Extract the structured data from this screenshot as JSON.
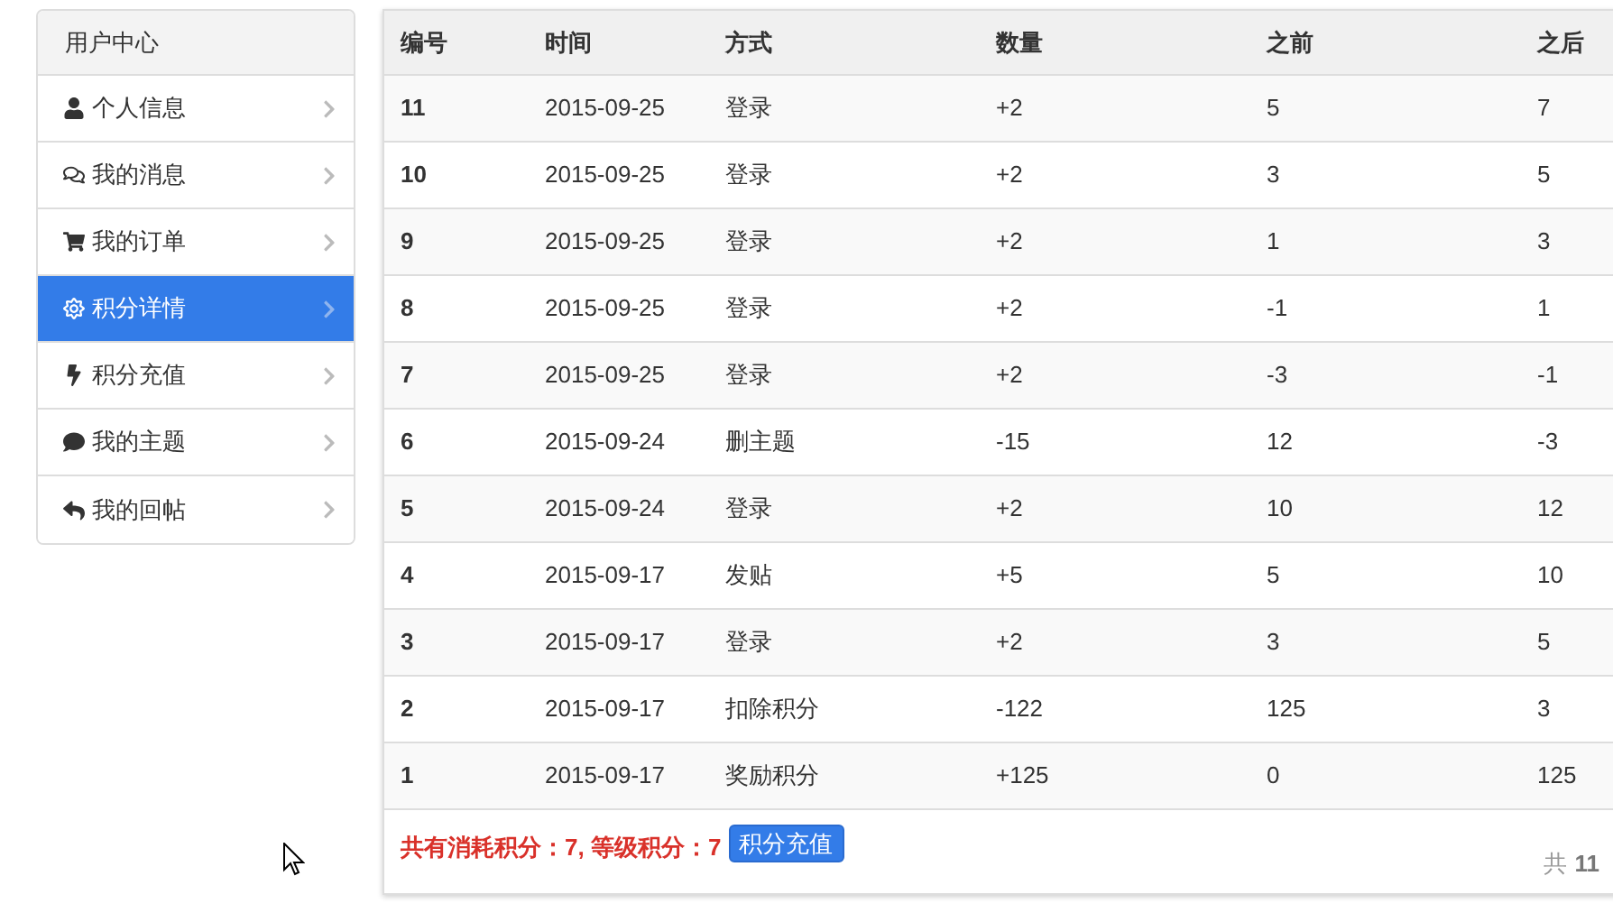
{
  "sidebar": {
    "title": "用户中心",
    "items": [
      {
        "label": "个人信息",
        "selected": false
      },
      {
        "label": "我的消息",
        "selected": false
      },
      {
        "label": "我的订单",
        "selected": false
      },
      {
        "label": "积分详情",
        "selected": true
      },
      {
        "label": "积分充值",
        "selected": false
      },
      {
        "label": "我的主题",
        "selected": false
      },
      {
        "label": "我的回帖",
        "selected": false
      }
    ]
  },
  "table": {
    "columns": [
      "编号",
      "时间",
      "方式",
      "数量",
      "之前",
      "之后"
    ],
    "rows": [
      [
        "11",
        "2015-09-25",
        "登录",
        "+2",
        "5",
        "7"
      ],
      [
        "10",
        "2015-09-25",
        "登录",
        "+2",
        "3",
        "5"
      ],
      [
        "9",
        "2015-09-25",
        "登录",
        "+2",
        "1",
        "3"
      ],
      [
        "8",
        "2015-09-25",
        "登录",
        "+2",
        "-1",
        "1"
      ],
      [
        "7",
        "2015-09-25",
        "登录",
        "+2",
        "-3",
        "-1"
      ],
      [
        "6",
        "2015-09-24",
        "删主题",
        "-15",
        "12",
        "-3"
      ],
      [
        "5",
        "2015-09-24",
        "登录",
        "+2",
        "10",
        "12"
      ],
      [
        "4",
        "2015-09-17",
        "发贴",
        "+5",
        "5",
        "10"
      ],
      [
        "3",
        "2015-09-17",
        "登录",
        "+2",
        "3",
        "5"
      ],
      [
        "2",
        "2015-09-17",
        "扣除积分",
        "-122",
        "125",
        "3"
      ],
      [
        "1",
        "2015-09-17",
        "奖励积分",
        "+125",
        "0",
        "125"
      ]
    ]
  },
  "footer": {
    "summary": "共有消耗积分：7, 等级积分：7",
    "button": "积分充值",
    "total_prefix": "共",
    "total": "11"
  }
}
